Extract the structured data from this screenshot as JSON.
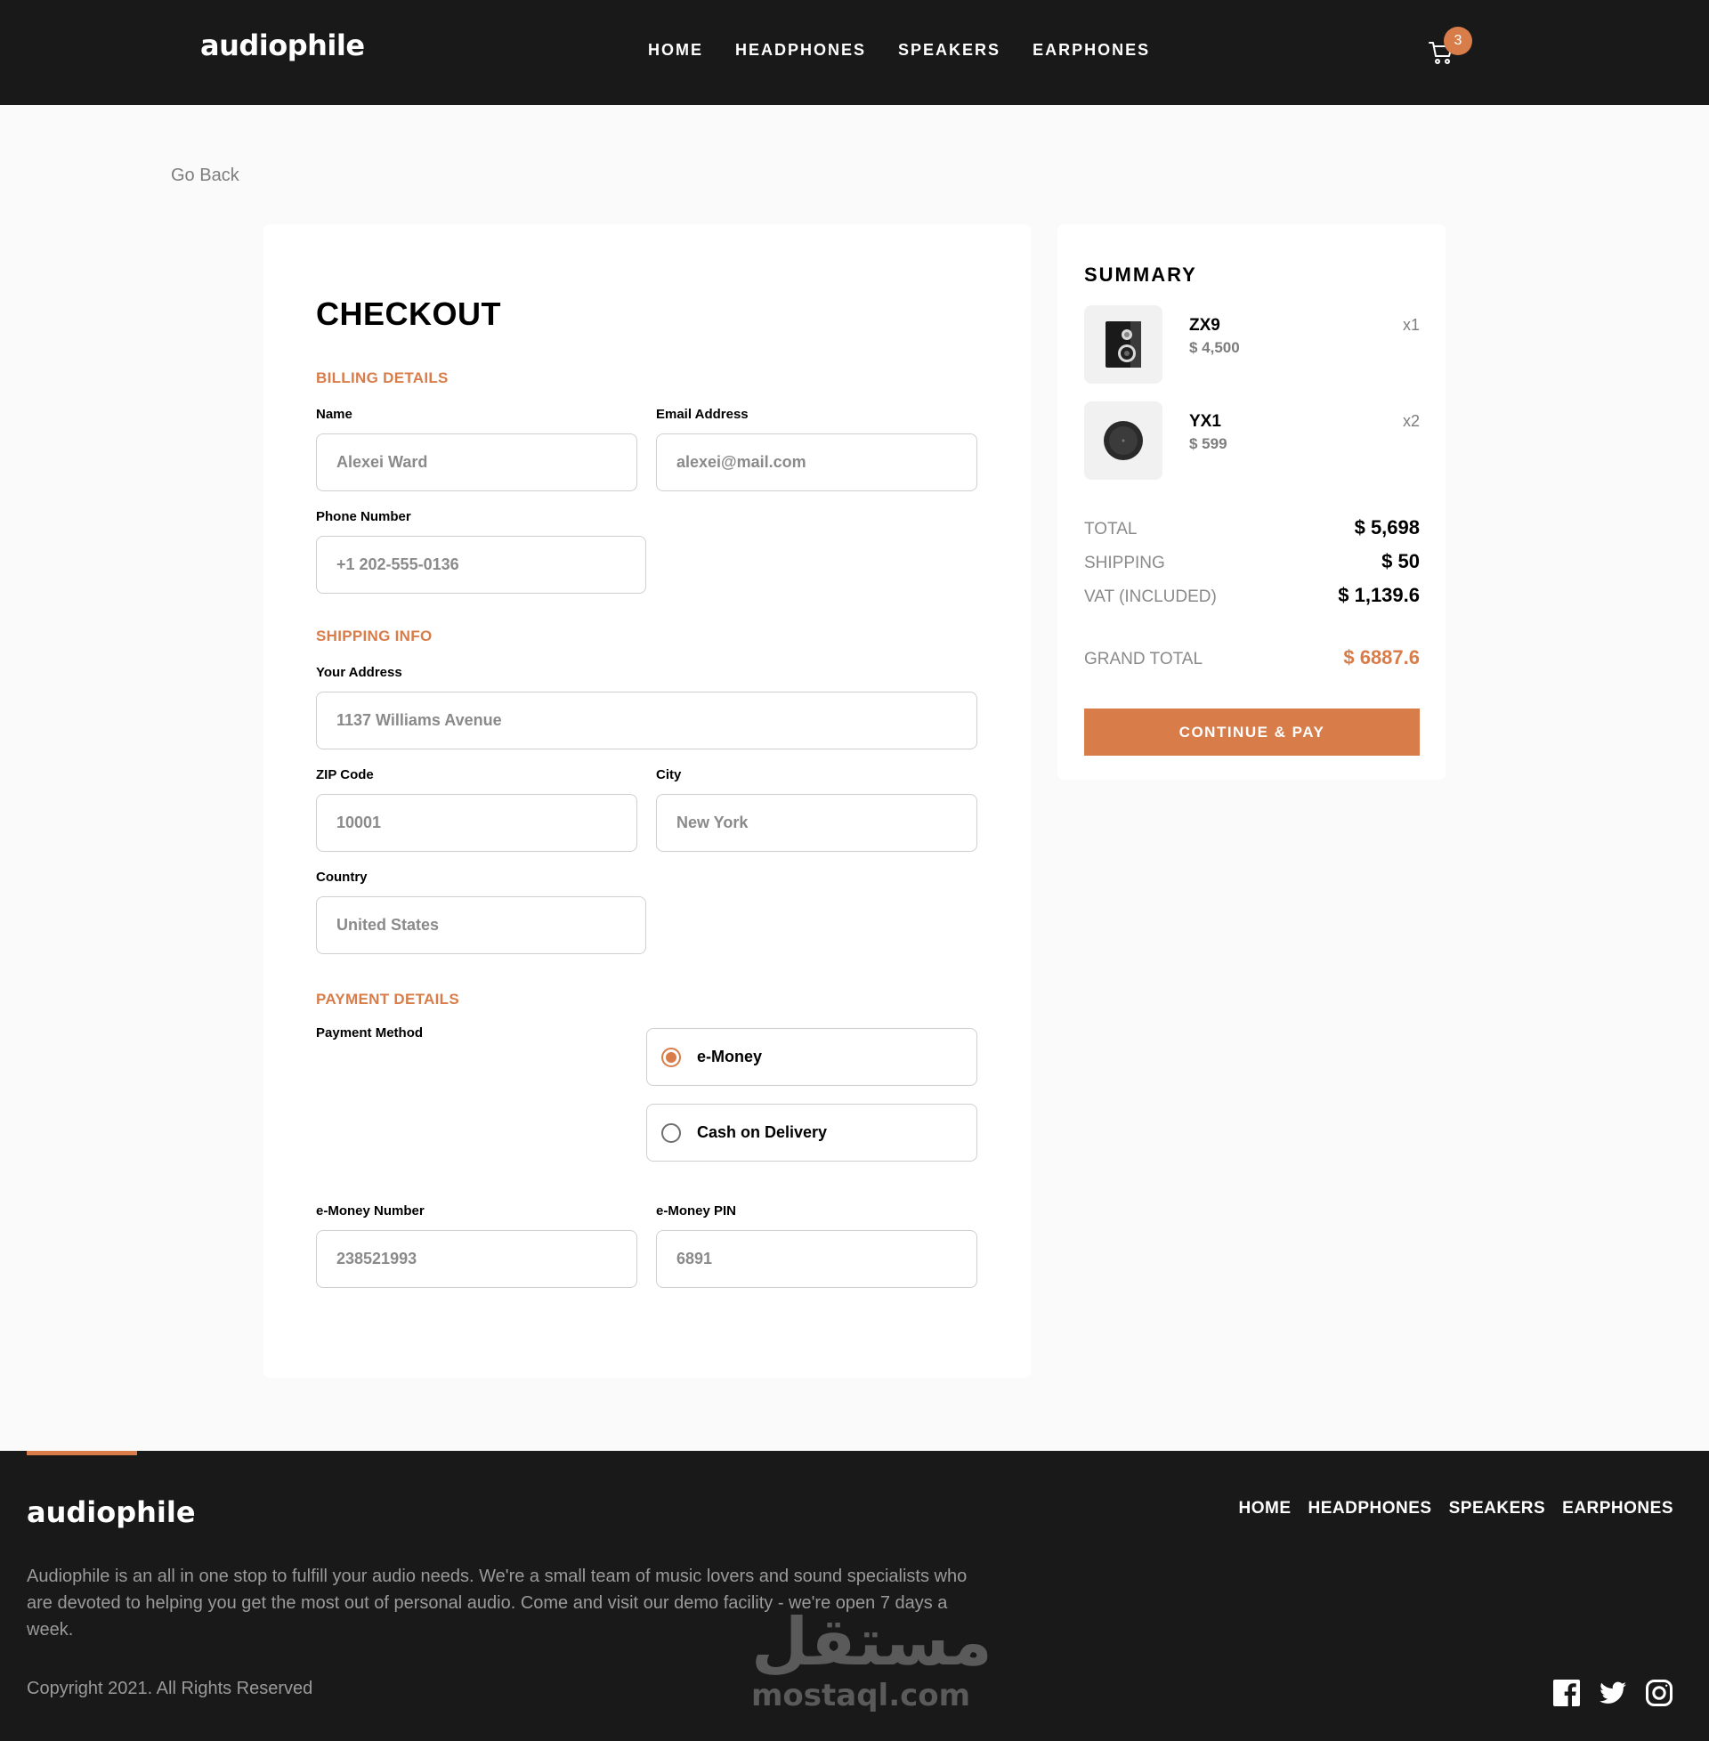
{
  "header": {
    "logo": "audiophile",
    "nav": [
      "HOME",
      "HEADPHONES",
      "SPEAKERS",
      "EARPHONES"
    ],
    "cart_count": "3"
  },
  "go_back": "Go Back",
  "checkout": {
    "title": "CHECKOUT",
    "billing": {
      "title": "BILLING DETAILS",
      "name_label": "Name",
      "name_placeholder": "Alexei Ward",
      "email_label": "Email Address",
      "email_placeholder": "alexei@mail.com",
      "phone_label": "Phone Number",
      "phone_placeholder": "+1 202-555-0136"
    },
    "shipping": {
      "title": "SHIPPING INFO",
      "address_label": "Your Address",
      "address_placeholder": "1137 Williams Avenue",
      "zip_label": "ZIP Code",
      "zip_placeholder": "10001",
      "city_label": "City",
      "city_placeholder": "New York",
      "country_label": "Country",
      "country_placeholder": "United States"
    },
    "payment": {
      "title": "PAYMENT DETAILS",
      "method_label": "Payment Method",
      "options": [
        {
          "label": "e-Money",
          "selected": true
        },
        {
          "label": "Cash on Delivery",
          "selected": false
        }
      ],
      "emoney_number_label": "e-Money Number",
      "emoney_number_placeholder": "238521993",
      "emoney_pin_label": "e-Money PIN",
      "emoney_pin_placeholder": "6891"
    }
  },
  "summary": {
    "title": "SUMMARY",
    "items": [
      {
        "name": "ZX9",
        "price": "$ 4,500",
        "qty": "x1",
        "icon": "speaker-icon"
      },
      {
        "name": "YX1",
        "price": "$ 599",
        "qty": "x2",
        "icon": "earphones-icon"
      }
    ],
    "total_label": "TOTAL",
    "total_value": "$ 5,698",
    "shipping_label": "SHIPPING",
    "shipping_value": "$ 50",
    "vat_label": "VAT (INCLUDED)",
    "vat_value": "$ 1,139.6",
    "grand_total_label": "GRAND TOTAL",
    "grand_total_value": "$ 6887.6",
    "pay_button": "CONTINUE & PAY"
  },
  "footer": {
    "logo": "audiophile",
    "nav": [
      "HOME",
      "HEADPHONES",
      "SPEAKERS",
      "EARPHONES"
    ],
    "about": "Audiophile is an all in one stop to fulfill your audio needs. We're a small team of music lovers and sound specialists who are devoted to helping you get the most out of personal audio. Come and visit our demo facility - we're open 7 days a week.",
    "copyright": "Copyright 2021. All Rights Reserved",
    "socials": [
      "facebook-icon",
      "twitter-icon",
      "instagram-icon"
    ],
    "watermark_ar": "مستقل",
    "watermark_en": "mostaql.com"
  },
  "colors": {
    "accent": "#d87d4a",
    "dark": "#191919",
    "background": "#fafafa"
  }
}
